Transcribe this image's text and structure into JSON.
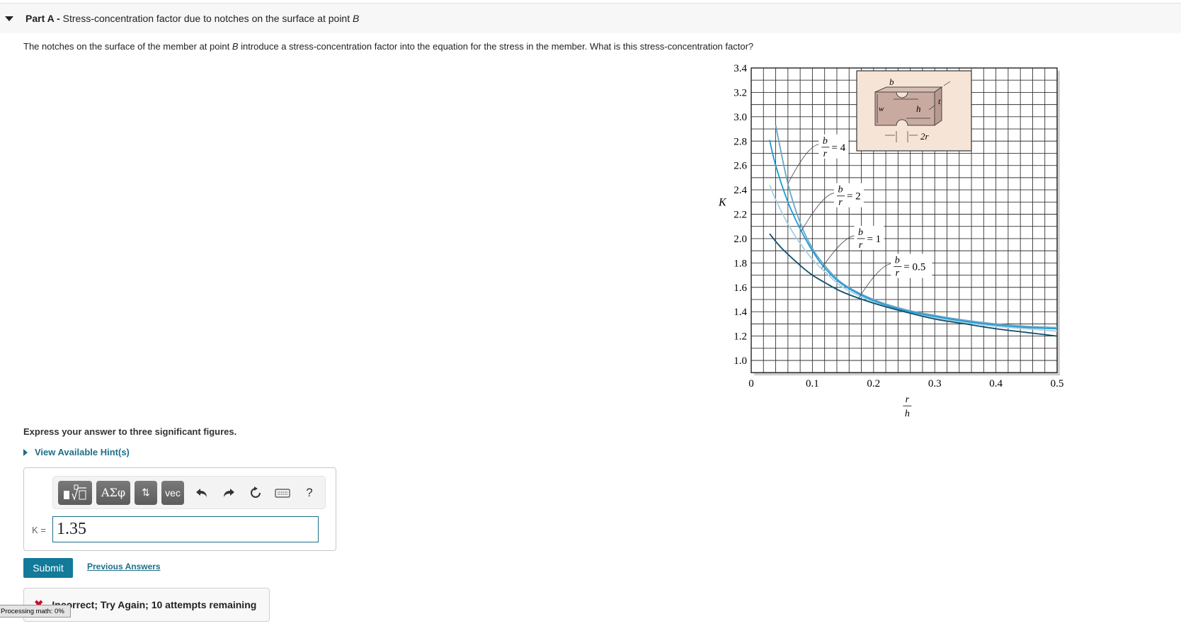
{
  "part": {
    "label": "Part A -",
    "title": "Stress-concentration factor due to notches on the surface at point ",
    "point": "B"
  },
  "question": {
    "before": "The notches on the surface of the member at point ",
    "point": "B",
    "after": " introduce a stress-concentration factor into the equation for the stress in the member. What is this stress-concentration factor?"
  },
  "instruction": "Express your answer to three significant figures.",
  "hints_label": "View Available Hint(s)",
  "toolbar": {
    "templates_icon": "fraction-root-template-icon",
    "greek_label": "ΑΣφ",
    "arrows_label": "⇅",
    "vec_label": "vec",
    "undo_icon": "undo-icon",
    "redo_icon": "redo-icon",
    "reset_icon": "reset-icon",
    "keyboard_icon": "keyboard-icon",
    "help_label": "?"
  },
  "answer": {
    "label": "K =",
    "value": "1.35"
  },
  "submit_label": "Submit",
  "previous_answers_label": "Previous Answers",
  "feedback": {
    "icon": "x-mark-icon",
    "text": "Incorrect; Try Again; 10 attempts remaining"
  },
  "mathjax_status": "Processing math: 0%",
  "colors": {
    "link": "#1d6f8a",
    "submit_bg": "#137a99",
    "error": "#c8102e",
    "inset_bg": "#f6e4d6"
  },
  "chart_data": {
    "type": "line",
    "title": "",
    "xlabel_num": "r",
    "xlabel_den": "h",
    "ylabel": "K",
    "xlim": [
      0,
      0.5
    ],
    "ylim": [
      0.9,
      3.4
    ],
    "x_ticks": [
      "0",
      "0.1",
      "0.2",
      "0.3",
      "0.4",
      "0.5"
    ],
    "x_tick_values": [
      0,
      0.1,
      0.2,
      0.3,
      0.4,
      0.5
    ],
    "y_ticks": [
      "1.0",
      "1.2",
      "1.4",
      "1.6",
      "1.8",
      "2.0",
      "2.2",
      "2.4",
      "2.6",
      "2.8",
      "3.0",
      "3.2",
      "3.4"
    ],
    "y_tick_values": [
      1.0,
      1.2,
      1.4,
      1.6,
      1.8,
      2.0,
      2.2,
      2.4,
      2.6,
      2.8,
      3.0,
      3.2,
      3.4
    ],
    "grid": true,
    "grid_step_x": 0.02,
    "grid_step_y": 0.1,
    "series": [
      {
        "name": "b/r = 4",
        "color": "#6aa7c6",
        "x": [
          0.04,
          0.06,
          0.08,
          0.1,
          0.12,
          0.15,
          0.2,
          0.25,
          0.3,
          0.35,
          0.4,
          0.45,
          0.5
        ],
        "y": [
          2.93,
          2.45,
          2.13,
          1.92,
          1.78,
          1.63,
          1.5,
          1.42,
          1.37,
          1.33,
          1.3,
          1.28,
          1.27
        ]
      },
      {
        "name": "b/r = 2",
        "color": "#1c9ad6",
        "x": [
          0.03,
          0.04,
          0.06,
          0.08,
          0.1,
          0.12,
          0.15,
          0.2,
          0.25,
          0.3,
          0.35,
          0.4,
          0.45,
          0.5
        ],
        "y": [
          2.81,
          2.6,
          2.3,
          2.08,
          1.9,
          1.76,
          1.62,
          1.49,
          1.41,
          1.36,
          1.32,
          1.29,
          1.27,
          1.26
        ]
      },
      {
        "name": "b/r = 1",
        "color": "#a7cfe3",
        "x": [
          0.03,
          0.04,
          0.06,
          0.08,
          0.1,
          0.12,
          0.15,
          0.2,
          0.25,
          0.3,
          0.35,
          0.4,
          0.45,
          0.5
        ],
        "y": [
          2.44,
          2.32,
          2.12,
          1.96,
          1.83,
          1.73,
          1.6,
          1.48,
          1.4,
          1.35,
          1.31,
          1.28,
          1.26,
          1.24
        ]
      },
      {
        "name": "b/r = 0.5",
        "color": "#0f4f6e",
        "x": [
          0.03,
          0.05,
          0.08,
          0.1,
          0.12,
          0.15,
          0.2,
          0.25,
          0.3,
          0.35,
          0.4,
          0.45,
          0.5
        ],
        "y": [
          2.04,
          1.92,
          1.78,
          1.7,
          1.64,
          1.56,
          1.47,
          1.4,
          1.34,
          1.3,
          1.26,
          1.23,
          1.2
        ]
      }
    ],
    "annotations": [
      {
        "num": "b",
        "den": "r",
        "value": "= 4",
        "series": "b/r = 4",
        "at_x": 0.06,
        "label_x": 0.115,
        "label_y": 2.75
      },
      {
        "num": "b",
        "den": "r",
        "value": "= 2",
        "series": "b/r = 2",
        "at_x": 0.082,
        "label_x": 0.14,
        "label_y": 2.35
      },
      {
        "num": "b",
        "den": "r",
        "value": "= 1",
        "series": "b/r = 1",
        "at_x": 0.115,
        "label_x": 0.173,
        "label_y": 2.0
      },
      {
        "num": "b",
        "den": "r",
        "value": "= 0.5",
        "series": "b/r = 0.5",
        "at_x": 0.176,
        "label_x": 0.233,
        "label_y": 1.77
      }
    ],
    "inset": {
      "labels": [
        "b",
        "w",
        "h",
        "t",
        "2r"
      ]
    }
  }
}
